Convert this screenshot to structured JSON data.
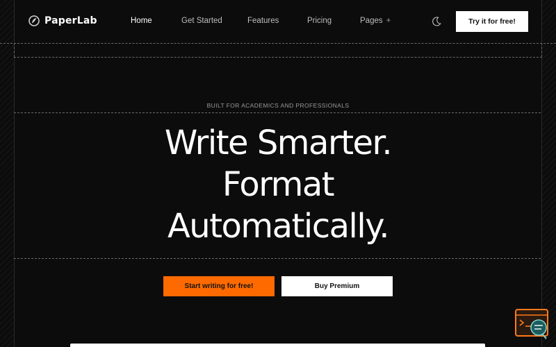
{
  "brand": {
    "name": "PaperLab",
    "logo_icon": "paperlab-logo-icon"
  },
  "nav": {
    "links": [
      {
        "label": "Home",
        "active": true
      },
      {
        "label": "Get Started",
        "active": false
      },
      {
        "label": "Features",
        "active": false
      },
      {
        "label": "Pricing",
        "active": false
      },
      {
        "label": "Pages",
        "active": false
      }
    ],
    "pages_expand_symbol": "+",
    "theme_toggle_icon": "moon-icon",
    "cta_label": "Try it for free!"
  },
  "hero": {
    "eyebrow": "BUILT FOR ACADEMICS AND PROFESSIONALS",
    "headline_lines": [
      "Write Smarter.",
      "Format",
      "Automatically."
    ],
    "primary_cta": "Start writing for free!",
    "secondary_cta": "Buy Premium"
  },
  "colors": {
    "background": "#0d0c0c",
    "accent": "#ff6a00",
    "text": "#ffffff",
    "muted_text": "#9a9a9a"
  },
  "widget": {
    "icon": "terminal-chat-icon"
  }
}
